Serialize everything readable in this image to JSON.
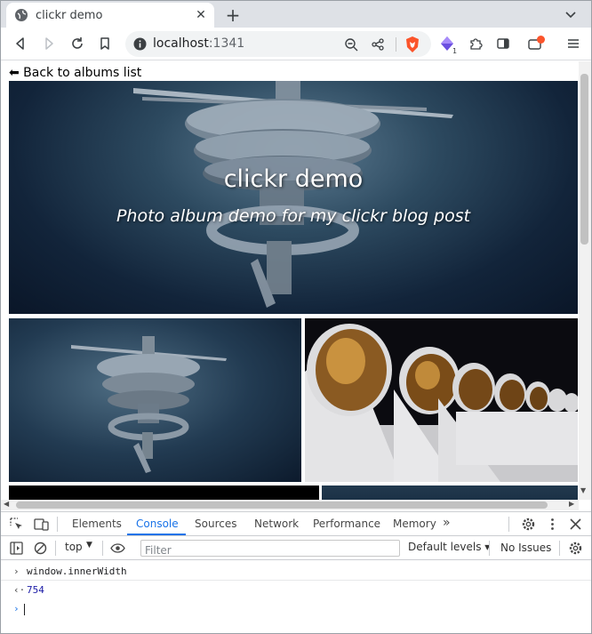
{
  "browser": {
    "tab_title": "clickr demo",
    "url_host": "localhost",
    "url_port": ":1341",
    "extension_badge": "1",
    "accent": "#1a73e8",
    "brave_color": "#fb542b"
  },
  "page": {
    "back_link": "⬅ Back to albums list",
    "hero_title": "clickr demo",
    "hero_subtitle": "Photo album demo for my clickr blog post"
  },
  "devtools": {
    "tabs": [
      "Elements",
      "Console",
      "Sources",
      "Network",
      "Performance",
      "Memory"
    ],
    "active_tab": "Console",
    "context": "top",
    "filter_placeholder": "Filter",
    "levels": "Default levels",
    "issues": "No Issues",
    "console": {
      "input": "window.innerWidth",
      "result": "754"
    }
  }
}
